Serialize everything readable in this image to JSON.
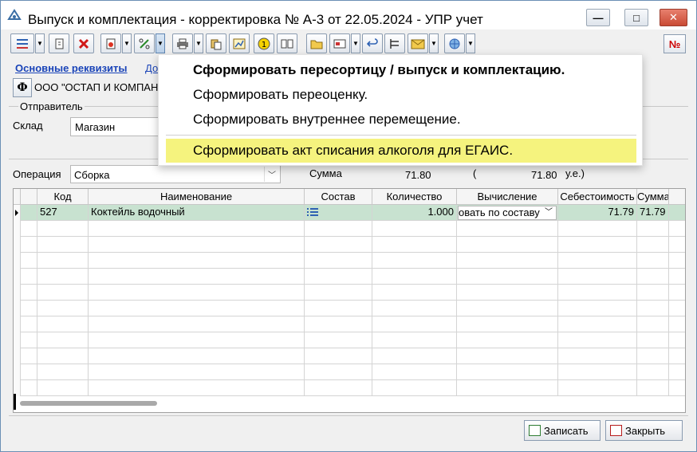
{
  "window": {
    "title": "Выпуск и комплектация - корректировка № А-3 от 22.05.2024 - УПР учет",
    "minimize": "—",
    "maximize": "□",
    "close": "✕"
  },
  "toolbar": {
    "no_label": "№",
    "icons": [
      "list-icon",
      "copy-icon",
      "delete-icon",
      "refresh-icon",
      "percent-icon",
      "print-icon",
      "paste-icon",
      "chart-icon",
      "one-icon",
      "book-icon",
      "folder-icon",
      "card-icon",
      "undo-icon",
      "tree-icon",
      "envelope-icon",
      "globe-icon"
    ]
  },
  "tabs": {
    "main": "Основные реквизиты",
    "second": "До"
  },
  "org": {
    "button": "Ф",
    "name": "ООО \"ОСТАП И КОМПАН"
  },
  "sender": {
    "group": "Отправитель",
    "sklad_label": "Склад",
    "sklad_value": "Магазин"
  },
  "operation": {
    "label": "Операция",
    "value": "Сборка",
    "sum_label": "Сумма",
    "sum_value": "71.80",
    "open_paren": "(",
    "sum_value2": "71.80",
    "currency": "у.е.)"
  },
  "grid": {
    "columns": [
      "Код",
      "Наименование",
      "Состав",
      "Количество",
      "Вычисление",
      "Себестоимость",
      "Сумма"
    ],
    "rows": [
      {
        "code": "527",
        "name": "Коктейль водочный",
        "qty": "1.000",
        "calc": "овать по составу",
        "cost": "71.79",
        "sum": "71.79"
      }
    ]
  },
  "buttons": {
    "save": "Записать",
    "close": "Закрыть"
  },
  "menu": {
    "items": [
      "Сформировать пересортицу / выпуск и комплектацию.",
      "Сформировать переоценку.",
      "Сформировать внутреннее перемещение.",
      "Сформировать акт списания алкоголя для ЕГАИС."
    ]
  },
  "colors": {
    "accent_link": "#1a44b8",
    "selected_row": "#c8e2d0",
    "menu_highlight": "#f5f37e"
  }
}
